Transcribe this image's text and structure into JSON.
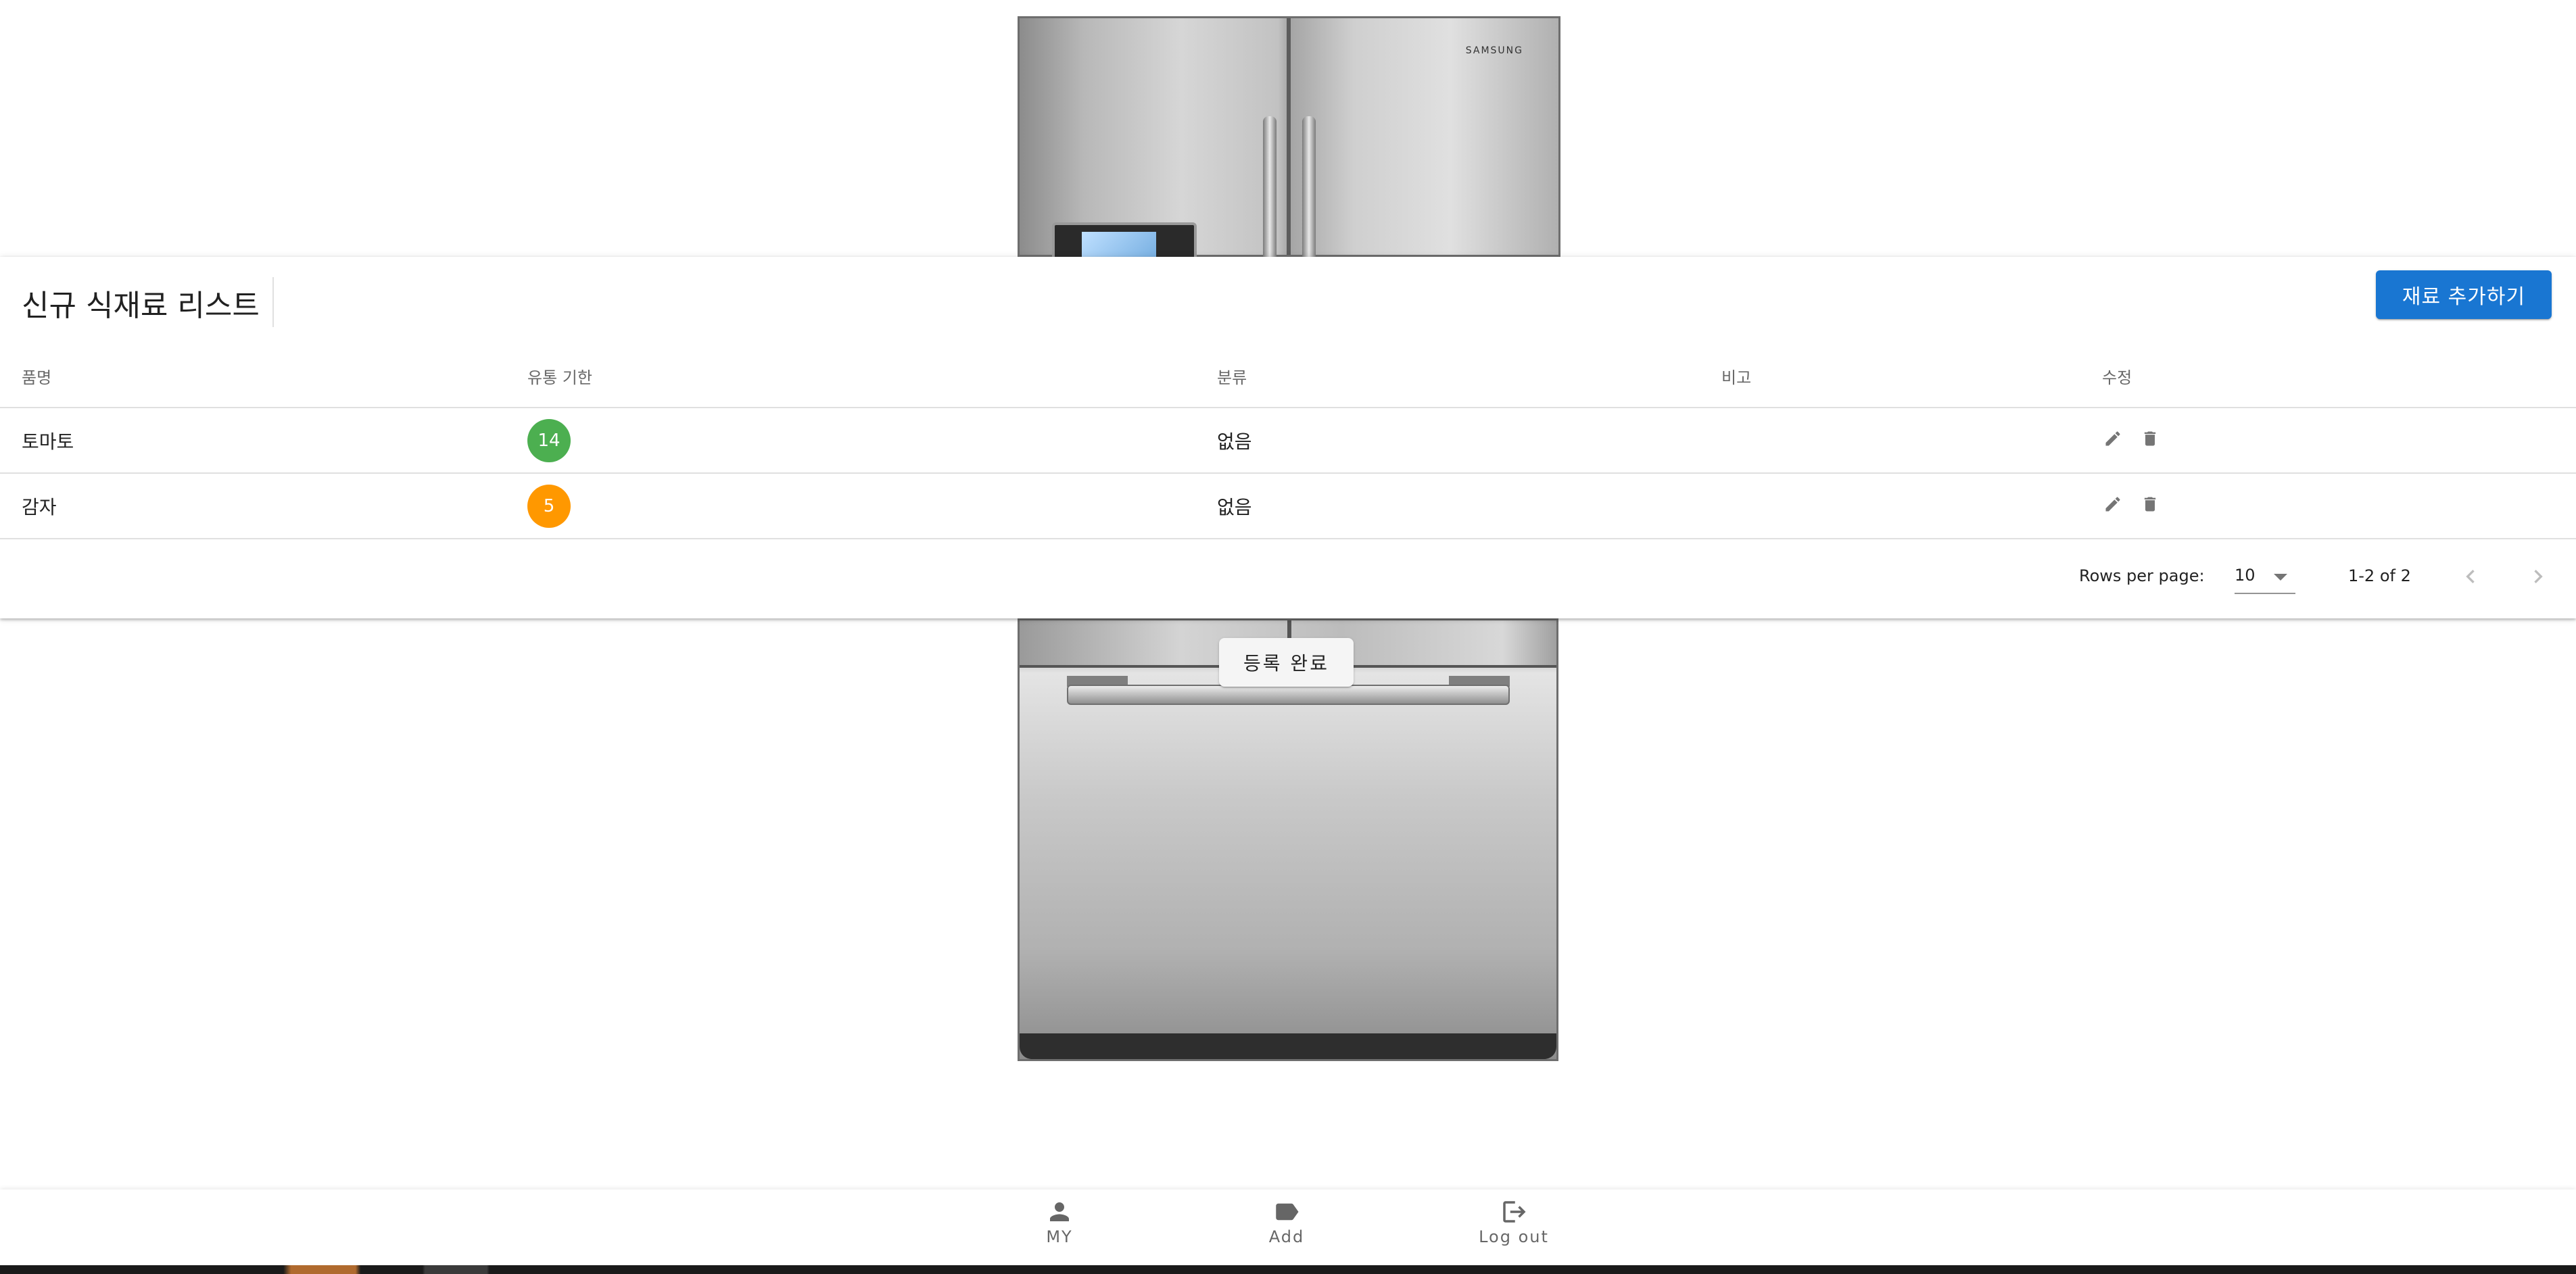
{
  "table": {
    "title": "신규 식재료 리스트",
    "add_button_label": "재료 추가하기",
    "columns": [
      "품명",
      "유통 기한",
      "분류",
      "비고",
      "수정"
    ],
    "rows": [
      {
        "name": "토마토",
        "expiry": "14",
        "expiry_color": "#4caf50",
        "category": "없음",
        "note": ""
      },
      {
        "name": "감자",
        "expiry": "5",
        "expiry_color": "#ff9800",
        "category": "없음",
        "note": ""
      }
    ],
    "rows_per_page_label": "Rows per page:",
    "rows_per_page_value": "10",
    "range_label": "1-2 of 2"
  },
  "done_button_label": "등록 완료",
  "fridge": {
    "brand": "SAMSUNG"
  },
  "bottom_nav": {
    "items": [
      {
        "label": "MY",
        "icon": "person-icon"
      },
      {
        "label": "Add",
        "icon": "label-icon"
      },
      {
        "label": "Log out",
        "icon": "logout-icon"
      }
    ]
  },
  "colors": {
    "primary": "#1976d2",
    "chip_green": "#4caf50",
    "chip_orange": "#ff9800"
  }
}
